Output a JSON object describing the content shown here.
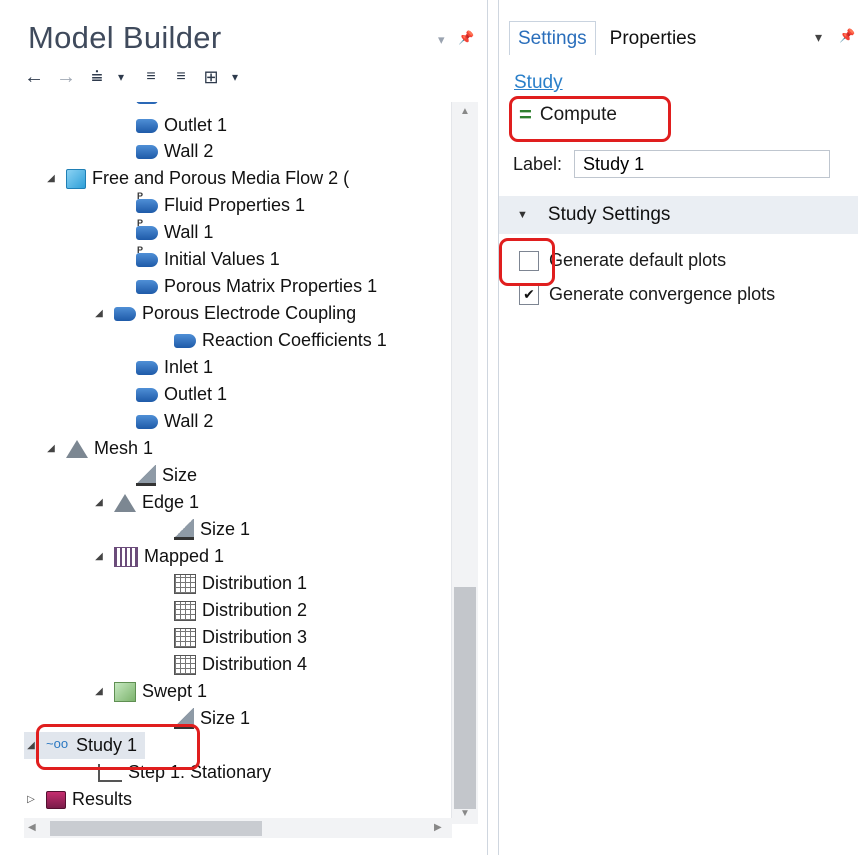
{
  "model_builder": {
    "title": "Model Builder",
    "toolbar": {
      "back": "←",
      "forward": "→",
      "show": "⩧",
      "show_menu": "▾",
      "expand": "≡",
      "collapse": "≡",
      "group": "⊞",
      "group_menu": "▾"
    },
    "tree": [
      {
        "label": "Outlet 1",
        "icon": "boundary-icon"
      },
      {
        "label": "Wall 2",
        "icon": "boundary-icon"
      },
      {
        "label": "Free and Porous Media Flow 2 (",
        "icon": "physics-cube-icon"
      },
      {
        "label": "Fluid Properties 1",
        "icon": "domain-icon"
      },
      {
        "label": "Wall 1",
        "icon": "domain-icon"
      },
      {
        "label": "Initial Values 1",
        "icon": "domain-icon"
      },
      {
        "label": "Porous Matrix Properties 1",
        "icon": "boundary-icon"
      },
      {
        "label": "Porous Electrode Coupling ",
        "icon": "boundary-icon"
      },
      {
        "label": "Reaction Coefficients 1",
        "icon": "boundary-icon"
      },
      {
        "label": "Inlet 1",
        "icon": "boundary-icon"
      },
      {
        "label": "Outlet 1",
        "icon": "boundary-icon"
      },
      {
        "label": "Wall 2",
        "icon": "boundary-icon"
      },
      {
        "label": "Mesh 1",
        "icon": "mesh-icon"
      },
      {
        "label": "Size",
        "icon": "size-icon"
      },
      {
        "label": "Edge 1",
        "icon": "mesh-icon"
      },
      {
        "label": "Size 1",
        "icon": "size-icon"
      },
      {
        "label": "Mapped 1",
        "icon": "mapped-icon"
      },
      {
        "label": "Distribution 1",
        "icon": "grid-icon"
      },
      {
        "label": "Distribution 2",
        "icon": "grid-icon"
      },
      {
        "label": "Distribution 3",
        "icon": "grid-icon"
      },
      {
        "label": "Distribution 4",
        "icon": "grid-icon"
      },
      {
        "label": "Swept 1",
        "icon": "swept-icon"
      },
      {
        "label": "Size 1",
        "icon": "size-icon"
      },
      {
        "label": "Study 1",
        "icon": "study-icon"
      },
      {
        "label": "Step 1: Stationary",
        "icon": "step-icon"
      },
      {
        "label": "Results",
        "icon": "results-icon"
      }
    ]
  },
  "settings_panel": {
    "tabs": [
      "Settings",
      "Properties"
    ],
    "tab_menu": "▾",
    "heading": "Study",
    "compute_label": "Compute",
    "label_field": {
      "caption": "Label:",
      "value": "Study 1"
    },
    "section_title": "Study Settings",
    "checkboxes": [
      {
        "label": "Generate default plots",
        "checked": false
      },
      {
        "label": "Generate convergence plots",
        "checked": true
      }
    ]
  },
  "annotations": {
    "highlight_color": "#e01e1e"
  }
}
